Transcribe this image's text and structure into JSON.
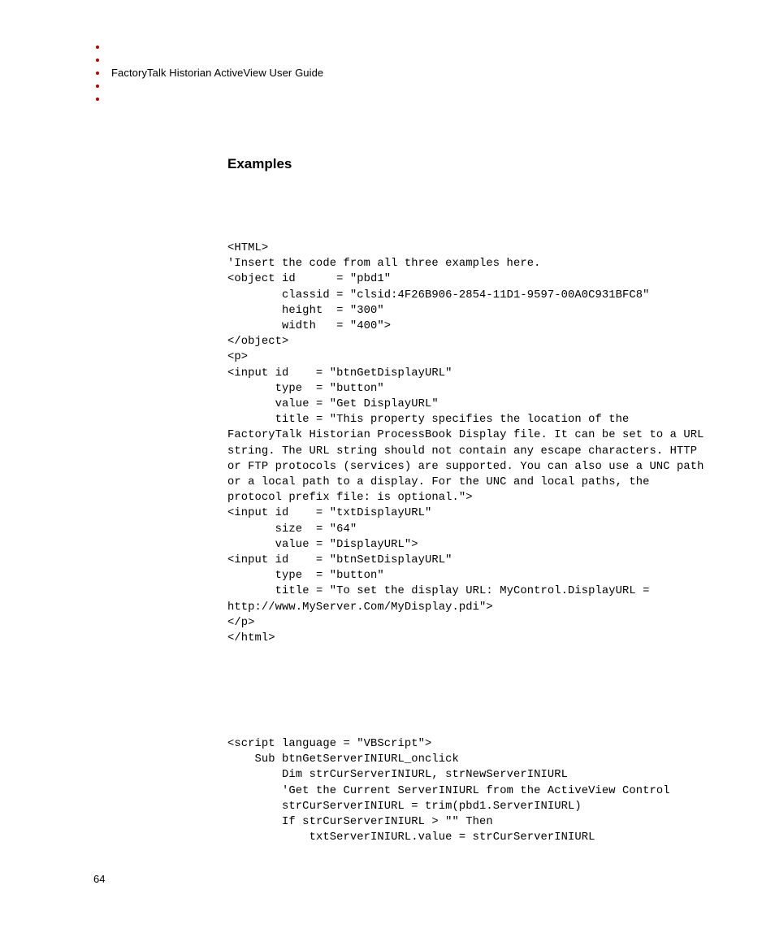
{
  "header": {
    "title": "FactoryTalk Historian ActiveView User Guide"
  },
  "section": {
    "heading": "Examples"
  },
  "code": {
    "block1": "<HTML>\n'Insert the code from all three examples here.\n<object id      = \"pbd1\"\n        classid = \"clsid:4F26B906-2854-11D1-9597-00A0C931BFC8\"\n        height  = \"300\"\n        width   = \"400\">\n</object>\n<p>\n<input id    = \"btnGetDisplayURL\"\n       type  = \"button\"\n       value = \"Get DisplayURL\"\n       title = \"This property specifies the location of the FactoryTalk Historian ProcessBook Display file. It can be set to a URL string. The URL string should not contain any escape characters. HTTP or FTP protocols (services) are supported. You can also use a UNC path or a local path to a display. For the UNC and local paths, the protocol prefix file: is optional.\">\n<input id    = \"txtDisplayURL\"\n       size  = \"64\"\n       value = \"DisplayURL\">\n<input id    = \"btnSetDisplayURL\"\n       type  = \"button\"\n       title = \"To set the display URL: MyControl.DisplayURL = http://www.MyServer.Com/MyDisplay.pdi\">\n</p>\n</html>",
    "block2": "<script language = \"VBScript\">\n    Sub btnGetServerINIURL_onclick\n        Dim strCurServerINIURL, strNewServerINIURL\n        'Get the Current ServerINIURL from the ActiveView Control\n        strCurServerINIURL = trim(pbd1.ServerINIURL)\n        If strCurServerINIURL > \"\" Then\n            txtServerINIURL.value = strCurServerINIURL"
  },
  "footer": {
    "page_number": "64"
  }
}
